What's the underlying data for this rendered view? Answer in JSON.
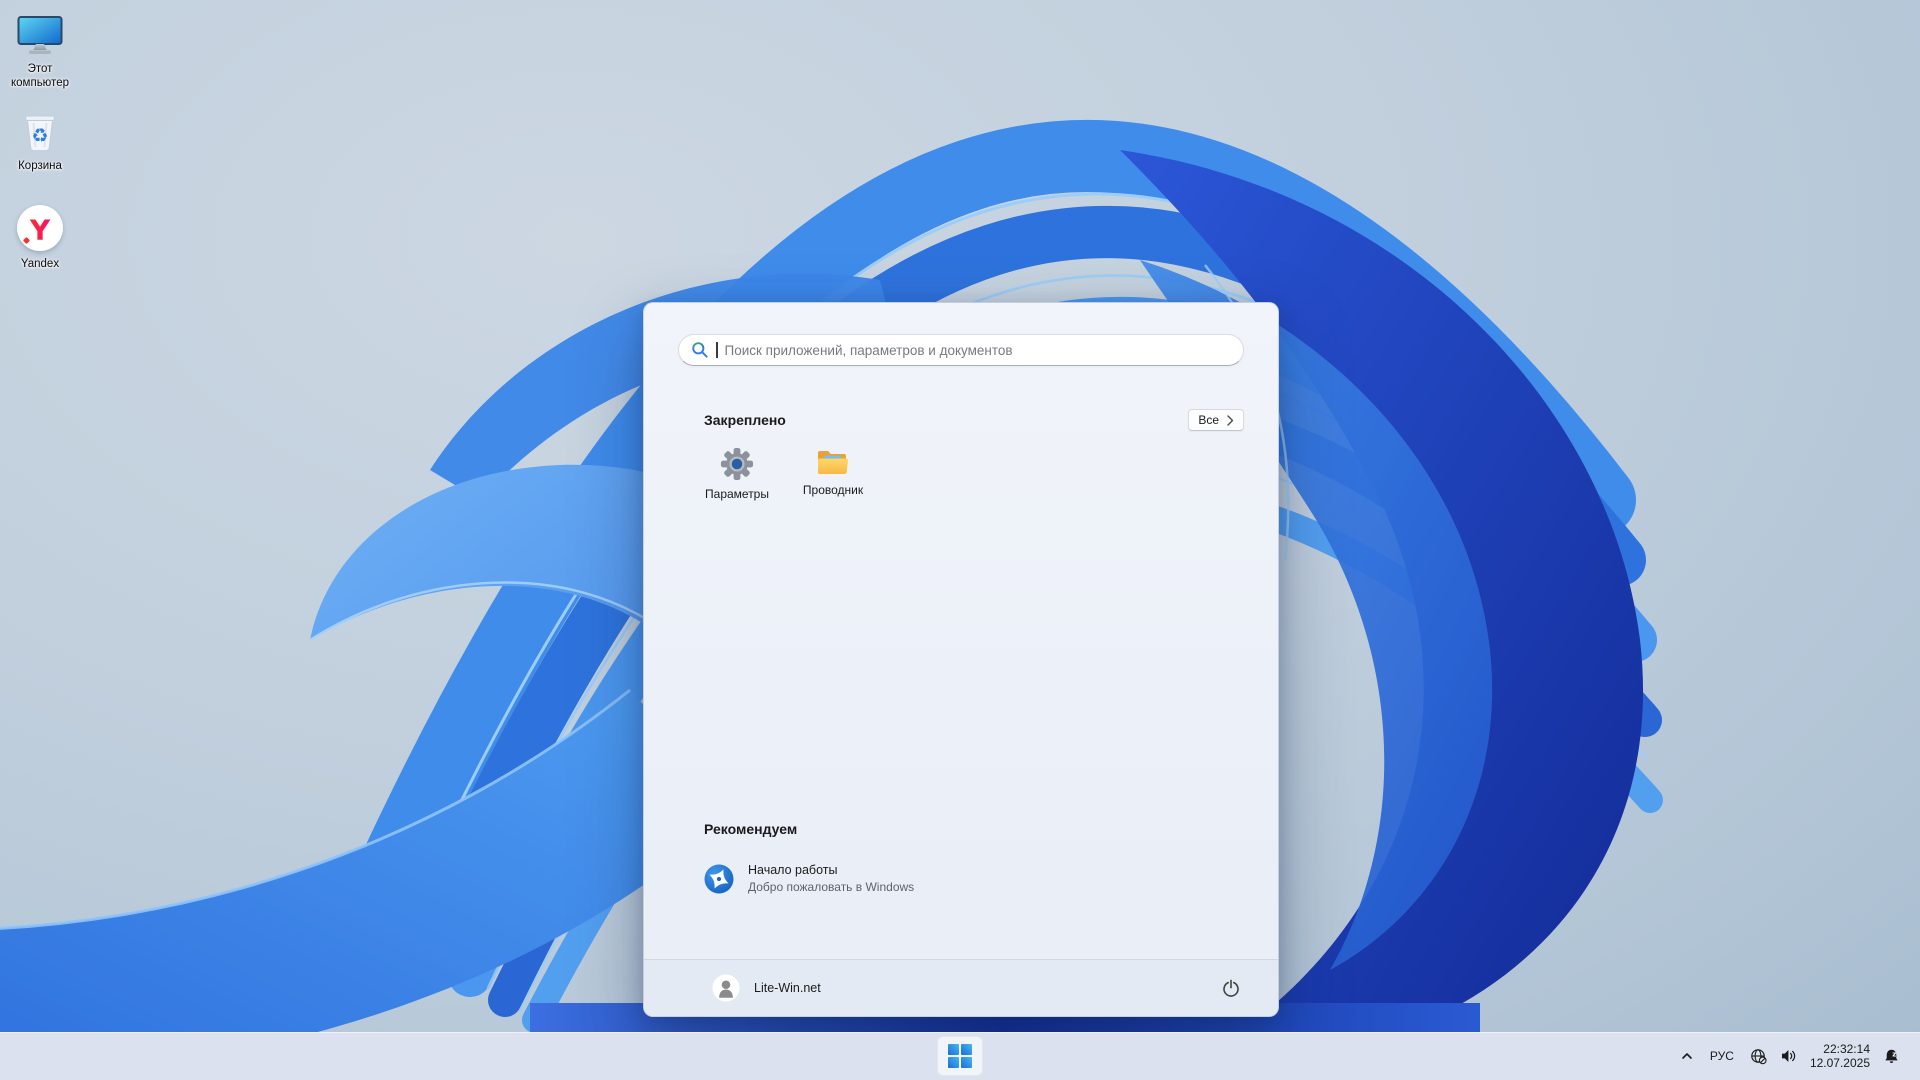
{
  "desktop": {
    "icons": [
      {
        "label": "Этот компьютер",
        "icon": "computer-icon"
      },
      {
        "label": "Корзина",
        "icon": "recycle-bin-icon"
      },
      {
        "label": "Yandex",
        "icon": "yandex-browser-icon",
        "letter": "Y"
      }
    ]
  },
  "start_menu": {
    "search": {
      "placeholder": "Поиск приложений, параметров и документов",
      "value": "",
      "icon": "search-icon"
    },
    "pinned": {
      "title": "Закреплено",
      "all_button": "Все",
      "apps": [
        {
          "label": "Параметры",
          "icon": "settings-gear-icon"
        },
        {
          "label": "Проводник",
          "icon": "folder-explorer-icon"
        }
      ]
    },
    "recommended": {
      "title": "Рекомендуем",
      "items": [
        {
          "title": "Начало работы",
          "subtitle": "Добро пожаловать в Windows",
          "icon": "get-started-icon"
        }
      ]
    },
    "footer": {
      "user": "Lite-Win.net",
      "user_icon": "user-avatar-icon",
      "power_icon": "power-icon"
    }
  },
  "taskbar": {
    "start_icon": "windows-start-icon",
    "tray": {
      "overflow_icon": "chevron-up-icon",
      "language": "РУС",
      "network_icon": "globe-no-internet-icon",
      "volume_icon": "speaker-icon",
      "time": "22:32:14",
      "date": "12.07.2025",
      "notification_icon": "bell-dnd-icon"
    }
  },
  "colors": {
    "accent_blue": "#2f7de1",
    "petal_light": "#4f9ef2",
    "petal_dark": "#122a96",
    "menu_bg": "#eef2f9",
    "taskbar_bg": "#dbe1ee"
  }
}
